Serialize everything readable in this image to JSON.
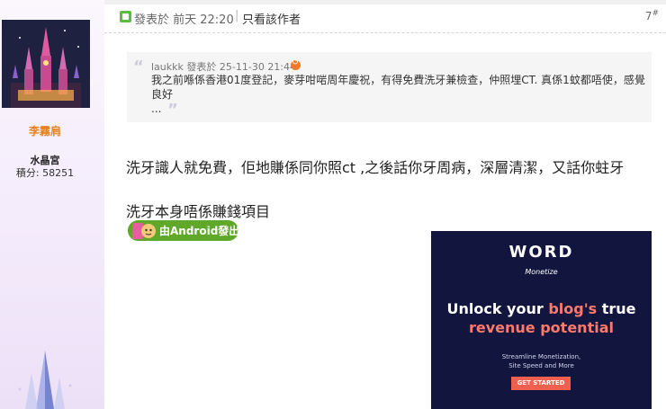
{
  "user": {
    "name": "李霧肩",
    "group": "水晶宮",
    "credits_label": "積分: 58251"
  },
  "post": {
    "time": "發表於 前天 22:20",
    "separator": "|",
    "only_author": "只看該作者",
    "floor": "7",
    "floor_mark": "#",
    "quote": {
      "author": "laukkk",
      "meta": "發表於 25-11-30 21:44",
      "text": "我之前喺係香港01度登記，麥芽咁啱周年慶祝，有得免費洗牙兼檢查，仲照埋CT. 真係1蚊都唔使，感覺良好",
      "ellipsis": "..."
    },
    "body_line1": "洗牙識人就免費，佢地賺係同你照ct ,之後話你牙周病，深層清潔，又話你蛀牙",
    "body_line2": "洗牙本身唔係賺錢項目",
    "android_badge": "由Android發出"
  },
  "ad": {
    "logo": "WORD",
    "logo_sub": "Monetize",
    "headline_a": "Unlock your ",
    "headline_b": "blog's",
    "headline_c": " true",
    "headline_d": "revenue potential",
    "sub_line1": "Streamline Monetization,",
    "sub_line2": "Site Speed and More",
    "cta": "GET STARTED"
  },
  "colors": {
    "username": "#e8811c",
    "badge": "#5fa82a",
    "ad_bg": "#12163f",
    "ad_accent": "#ff7a6a"
  }
}
